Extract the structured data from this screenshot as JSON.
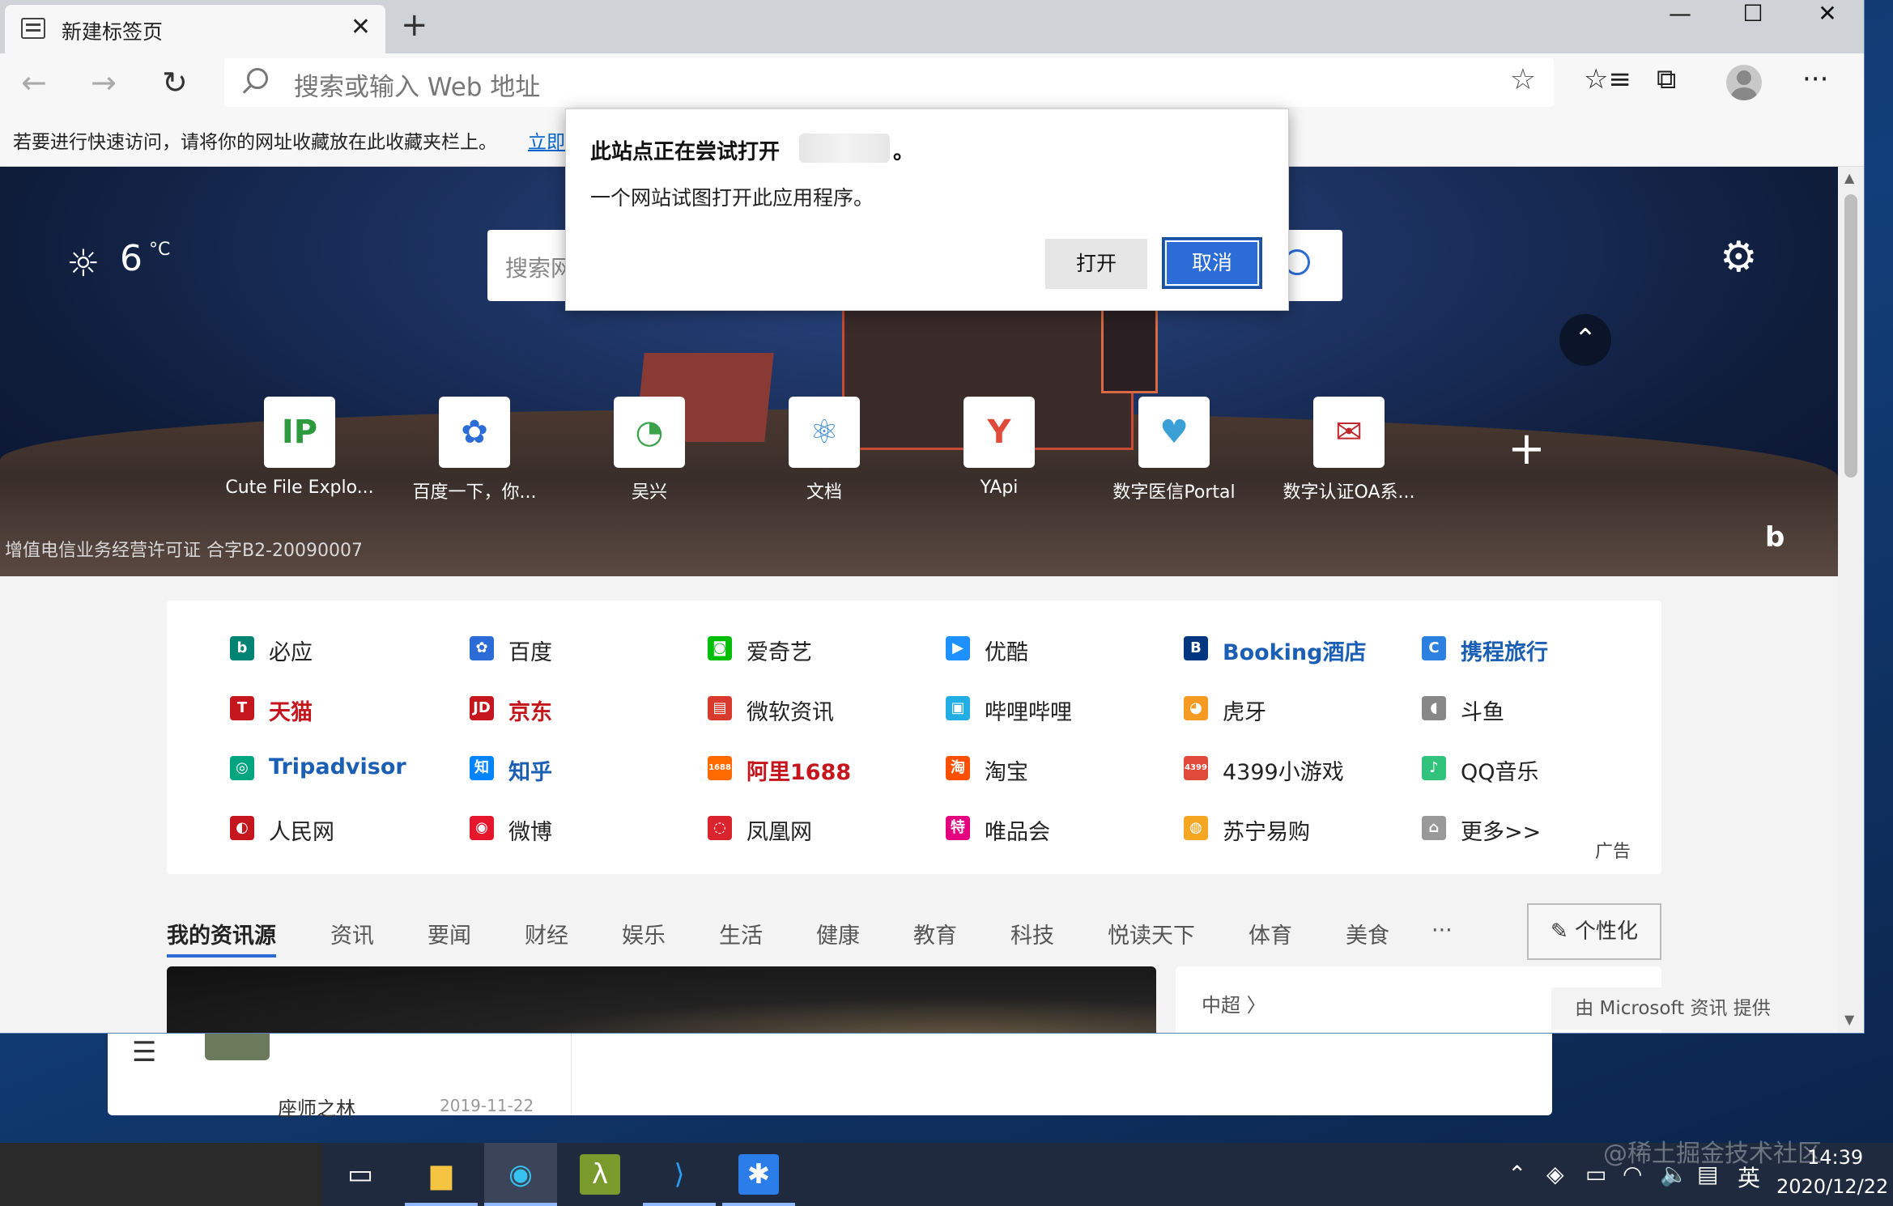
{
  "browser": {
    "tab_title": "新建标签页",
    "tab_close": "✕",
    "new_tab": "+",
    "window_controls": {
      "minimize": "—",
      "maximize": "☐",
      "close": "✕"
    },
    "address_placeholder": "搜索或输入 Web 地址",
    "favbar_hint": "若要进行快速访问，请将你的网址收藏放在此收藏夹栏上。",
    "favbar_link": "立即",
    "icons": {
      "back": "←",
      "forward": "→",
      "refresh": "↻",
      "star": "☆",
      "favorites": "☆≡",
      "collections": "⧉",
      "more": "···"
    }
  },
  "dialog": {
    "title_prefix": "此站点正在尝试打开",
    "title_suffix": "。",
    "body": "一个网站试图打开此应用程序。",
    "open_label": "打开",
    "cancel_label": "取消"
  },
  "hero": {
    "weather_icon": "☼",
    "temperature": "6",
    "unit": "°C",
    "search_placeholder": "搜索网",
    "gear_icon": "⚙",
    "collapse_icon": "⌃",
    "license": "增值电信业务经营许可证 合字B2-20090007",
    "bing_mark": "b",
    "add_icon": "+"
  },
  "tiles": [
    {
      "label": "Cute File Explo...",
      "glyph": "IP",
      "color": "#2e9a3e"
    },
    {
      "label": "百度一下，你...",
      "glyph": "✿",
      "color": "#2b6cd6"
    },
    {
      "label": "吴兴",
      "glyph": "◔",
      "color": "#3aa34a"
    },
    {
      "label": "文档",
      "glyph": "⚛",
      "color": "#3a8ad6"
    },
    {
      "label": "YApi",
      "glyph": "Y",
      "color": "#e04a3a"
    },
    {
      "label": "数字医信Portal",
      "glyph": "♥",
      "color": "#3aa0d6"
    },
    {
      "label": "数字认证OA系...",
      "glyph": "✉",
      "color": "#c0282d"
    }
  ],
  "links": {
    "rows": [
      [
        {
          "text": "必应",
          "glyph": "b",
          "color": "#008373",
          "highlight": false
        },
        {
          "text": "百度",
          "glyph": "✿",
          "color": "#2b6cd6",
          "highlight": false
        },
        {
          "text": "爱奇艺",
          "glyph": "◙",
          "color": "#00be06",
          "highlight": false
        },
        {
          "text": "优酷",
          "glyph": "▶",
          "color": "#1e90ff",
          "highlight": false
        },
        {
          "text": "Booking酒店",
          "glyph": "B",
          "color": "#003580",
          "highlight": true,
          "text_color": "#1a5fb4"
        },
        {
          "text": "携程旅行",
          "glyph": "C",
          "color": "#2b80e0",
          "highlight": true,
          "text_color": "#1a5fb4"
        }
      ],
      [
        {
          "text": "天猫",
          "glyph": "T",
          "color": "#c4161c",
          "highlight": true,
          "text_color": "#c4161c"
        },
        {
          "text": "京东",
          "glyph": "JD",
          "color": "#c4161c",
          "highlight": true,
          "text_color": "#c4161c"
        },
        {
          "text": "微软资讯",
          "glyph": "▤",
          "color": "#d83a2c",
          "highlight": false
        },
        {
          "text": "哔哩哔哩",
          "glyph": "▣",
          "color": "#23ade5",
          "highlight": false
        },
        {
          "text": "虎牙",
          "glyph": "◕",
          "color": "#f59a23",
          "highlight": false
        },
        {
          "text": "斗鱼",
          "glyph": "◖",
          "color": "#888888",
          "highlight": false
        }
      ],
      [
        {
          "text": "Tripadvisor",
          "glyph": "◎",
          "color": "#00a680",
          "highlight": true,
          "text_color": "#1a5fb4"
        },
        {
          "text": "知乎",
          "glyph": "知",
          "color": "#0084ff",
          "highlight": true,
          "text_color": "#1a5fb4"
        },
        {
          "text": "阿里1688",
          "glyph": "1688",
          "color": "#ff6a00",
          "highlight": true,
          "text_color": "#c4161c"
        },
        {
          "text": "淘宝",
          "glyph": "淘",
          "color": "#ff5000",
          "highlight": false
        },
        {
          "text": "4399小游戏",
          "glyph": "4399",
          "color": "#e04a3a",
          "highlight": false
        },
        {
          "text": "QQ音乐",
          "glyph": "♪",
          "color": "#31c27c",
          "highlight": false
        }
      ],
      [
        {
          "text": "人民网",
          "glyph": "◐",
          "color": "#c4161c",
          "highlight": false
        },
        {
          "text": "微博",
          "glyph": "◉",
          "color": "#e6162d",
          "highlight": false
        },
        {
          "text": "凤凰网",
          "glyph": "◌",
          "color": "#d9232d",
          "highlight": false
        },
        {
          "text": "唯品会",
          "glyph": "特",
          "color": "#e4007f",
          "highlight": false
        },
        {
          "text": "苏宁易购",
          "glyph": "◍",
          "color": "#f5a623",
          "highlight": false
        },
        {
          "text": "更多>>",
          "glyph": "⌂",
          "color": "#999999",
          "highlight": false
        }
      ]
    ],
    "ad_label": "广告"
  },
  "feed": {
    "tabs": [
      "我的资讯源",
      "资讯",
      "要闻",
      "财经",
      "娱乐",
      "生活",
      "健康",
      "教育",
      "科技",
      "悦读天下",
      "体育",
      "美食",
      "···"
    ],
    "personalize": "✎ 个性化",
    "side_label": "中超 〉",
    "provider": "由 Microsoft 资讯 提供"
  },
  "behind": {
    "hamburger": "☰",
    "peek_text": "座师之林",
    "peek_date": "2019-11-22"
  },
  "taskbar": {
    "tray_icons": [
      "⌃",
      "◈",
      "▭",
      "◠",
      "🔈",
      "▤",
      "英"
    ],
    "time": "14:39",
    "date": "2020/12/22",
    "watermark": "@稀土掘金技术社区"
  }
}
